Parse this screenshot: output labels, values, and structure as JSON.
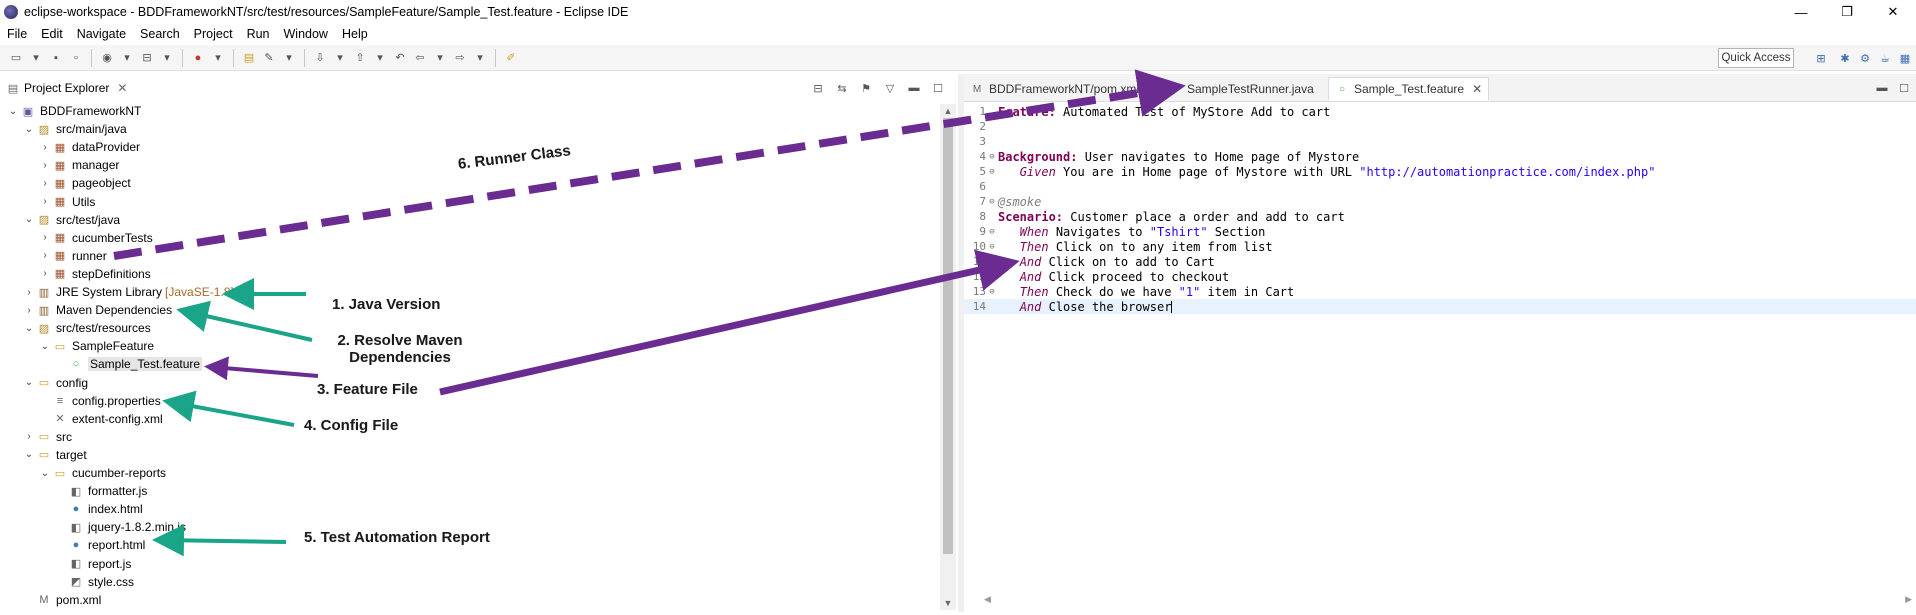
{
  "window": {
    "title": "eclipse-workspace - BDDFrameworkNT/src/test/resources/SampleFeature/Sample_Test.feature - Eclipse IDE",
    "minimize_label": "—",
    "maximize_label": "❐",
    "close_label": "✕"
  },
  "menubar": {
    "items": [
      "File",
      "Edit",
      "Navigate",
      "Search",
      "Project",
      "Run",
      "Window",
      "Help"
    ]
  },
  "toolbar": {
    "quick_access": "Quick Access"
  },
  "explorer": {
    "tab_label": "Project Explorer",
    "close_label": "✕",
    "tree": [
      {
        "label": "BDDFrameworkNT",
        "icon": "project-icon",
        "twisty": "open",
        "depth": 0
      },
      {
        "label": "src/main/java",
        "icon": "source-folder-icon",
        "twisty": "open",
        "depth": 1
      },
      {
        "label": "dataProvider",
        "icon": "package-icon",
        "twisty": "closed",
        "depth": 2
      },
      {
        "label": "manager",
        "icon": "package-icon",
        "twisty": "closed",
        "depth": 2
      },
      {
        "label": "pageobject",
        "icon": "package-icon",
        "twisty": "closed",
        "depth": 2
      },
      {
        "label": "Utils",
        "icon": "package-icon",
        "twisty": "closed",
        "depth": 2
      },
      {
        "label": "src/test/java",
        "icon": "source-folder-icon",
        "twisty": "open",
        "depth": 1
      },
      {
        "label": "cucumberTests",
        "icon": "package-icon",
        "twisty": "closed",
        "depth": 2
      },
      {
        "label": "runner",
        "icon": "package-icon",
        "twisty": "closed",
        "depth": 2
      },
      {
        "label": "stepDefinitions",
        "icon": "package-icon",
        "twisty": "closed",
        "depth": 2
      },
      {
        "label": "JRE System Library",
        "decoration": "[JavaSE-1.8]",
        "icon": "library-icon",
        "twisty": "closed",
        "depth": 1
      },
      {
        "label": "Maven Dependencies",
        "icon": "library-icon",
        "twisty": "closed",
        "depth": 1
      },
      {
        "label": "src/test/resources",
        "icon": "source-folder-icon",
        "twisty": "open",
        "depth": 1
      },
      {
        "label": "SampleFeature",
        "icon": "folder-icon",
        "twisty": "open",
        "depth": 2
      },
      {
        "label": "Sample_Test.feature",
        "icon": "feature-file-icon",
        "twisty": "none",
        "depth": 3,
        "selected": true
      },
      {
        "label": "config",
        "icon": "folder-icon",
        "twisty": "open",
        "depth": 1
      },
      {
        "label": "config.properties",
        "icon": "properties-file-icon",
        "twisty": "none",
        "depth": 2
      },
      {
        "label": "extent-config.xml",
        "icon": "xml-file-icon",
        "twisty": "none",
        "depth": 2
      },
      {
        "label": "src",
        "icon": "folder-icon",
        "twisty": "closed",
        "depth": 1
      },
      {
        "label": "target",
        "icon": "folder-icon",
        "twisty": "open",
        "depth": 1
      },
      {
        "label": "cucumber-reports",
        "icon": "folder-icon",
        "twisty": "open",
        "depth": 2
      },
      {
        "label": "formatter.js",
        "icon": "js-file-icon",
        "twisty": "none",
        "depth": 3
      },
      {
        "label": "index.html",
        "icon": "html-file-icon",
        "twisty": "none",
        "depth": 3
      },
      {
        "label": "jquery-1.8.2.min.js",
        "icon": "js-file-icon",
        "twisty": "none",
        "depth": 3
      },
      {
        "label": "report.html",
        "icon": "html-file-icon",
        "twisty": "none",
        "depth": 3
      },
      {
        "label": "report.js",
        "icon": "js-file-icon",
        "twisty": "none",
        "depth": 3
      },
      {
        "label": "style.css",
        "icon": "css-file-icon",
        "twisty": "none",
        "depth": 3
      },
      {
        "label": "pom.xml",
        "icon": "pom-file-icon",
        "twisty": "none",
        "depth": 1
      }
    ]
  },
  "editor": {
    "tabs": [
      {
        "label": "BDDFrameworkNT/pom.xml",
        "icon": "pom-file-icon",
        "active": false
      },
      {
        "label": "SampleTestRunner.java",
        "icon": "java-file-icon",
        "active": false
      },
      {
        "label": "Sample_Test.feature",
        "icon": "feature-file-icon",
        "active": true
      }
    ],
    "tab_close": "✕",
    "lines": [
      {
        "n": "1",
        "fold": "",
        "parts": [
          [
            "kw",
            "Feature:"
          ],
          [
            "txt",
            " Automated Test of MyStore Add to cart"
          ]
        ]
      },
      {
        "n": "2",
        "fold": "",
        "parts": []
      },
      {
        "n": "3",
        "fold": "",
        "parts": []
      },
      {
        "n": "4",
        "fold": "⊖",
        "parts": [
          [
            "kw",
            "Background:"
          ],
          [
            "txt",
            " User navigates to Home page of Mystore"
          ]
        ]
      },
      {
        "n": "5",
        "fold": "⊖",
        "parts": [
          [
            "txt",
            "   "
          ],
          [
            "step",
            "Given"
          ],
          [
            "txt",
            " You are in Home page of Mystore with URL "
          ],
          [
            "str",
            "\"http://automationpractice.com/index.php\""
          ]
        ]
      },
      {
        "n": "6",
        "fold": "",
        "parts": []
      },
      {
        "n": "7",
        "fold": "⊖",
        "parts": [
          [
            "tag",
            "@smoke"
          ]
        ]
      },
      {
        "n": "8",
        "fold": "",
        "parts": [
          [
            "kw",
            "Scenario:"
          ],
          [
            "txt",
            " Customer place a order and add to cart"
          ]
        ]
      },
      {
        "n": "9",
        "fold": "⊖",
        "parts": [
          [
            "txt",
            "   "
          ],
          [
            "step",
            "When"
          ],
          [
            "txt",
            " Navigates to "
          ],
          [
            "str",
            "\"Tshirt\""
          ],
          [
            "txt",
            " Section"
          ]
        ]
      },
      {
        "n": "10",
        "fold": "⊖",
        "parts": [
          [
            "txt",
            "   "
          ],
          [
            "step",
            "Then"
          ],
          [
            "txt",
            " Click on to any item from list"
          ]
        ]
      },
      {
        "n": "11",
        "fold": "⊖",
        "parts": [
          [
            "txt",
            "   "
          ],
          [
            "step",
            "And"
          ],
          [
            "txt",
            " Click on to add to Cart"
          ]
        ]
      },
      {
        "n": "12",
        "fold": "⊖",
        "parts": [
          [
            "txt",
            "   "
          ],
          [
            "step",
            "And"
          ],
          [
            "txt",
            " Click proceed to checkout"
          ]
        ]
      },
      {
        "n": "13",
        "fold": "⊖",
        "parts": [
          [
            "txt",
            "   "
          ],
          [
            "step",
            "Then"
          ],
          [
            "txt",
            " Check do we have "
          ],
          [
            "str",
            "\"1\""
          ],
          [
            "txt",
            " item in Cart"
          ]
        ]
      },
      {
        "n": "14",
        "fold": "",
        "parts": [
          [
            "txt",
            "   "
          ],
          [
            "step",
            "And"
          ],
          [
            "txt",
            " Close the browser"
          ]
        ],
        "current": true
      }
    ]
  },
  "annotations": {
    "java_version": "1. Java Version",
    "maven_deps_line1": "2. Resolve Maven",
    "maven_deps_line2": "Dependencies",
    "feature_file": "3. Feature File",
    "config_file": "4. Config File",
    "test_report": "5. Test Automation Report",
    "runner_class": "6. Runner Class",
    "teal_color": "#1aa488",
    "purple_color": "#6a2c91"
  }
}
